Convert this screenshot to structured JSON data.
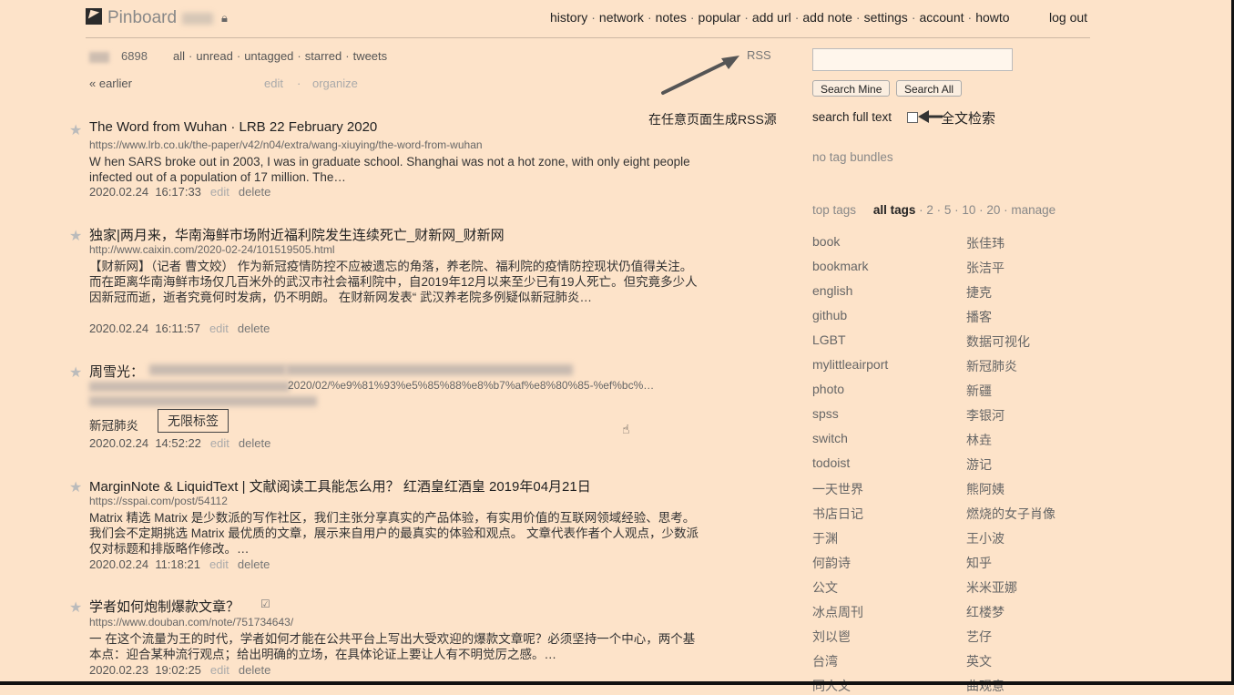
{
  "brand": "Pinboard",
  "topnav": [
    "history",
    "network",
    "notes",
    "popular",
    "add url",
    "add note",
    "settings",
    "account",
    "howto"
  ],
  "logout": "log out",
  "count": "6898",
  "filters": [
    "all",
    "unread",
    "untagged",
    "starred",
    "tweets"
  ],
  "earlier": "« earlier",
  "edit": "edit",
  "organize": "organize",
  "rss": "RSS",
  "rss_annotation": "在任意页面生成RSS源",
  "bookmarks": [
    {
      "title": "The Word from Wuhan · LRB 22 February 2020",
      "url": "https://www.lrb.co.uk/the-paper/v42/n04/extra/wang-xiuying/the-word-from-wuhan",
      "desc": "W hen SARS broke out in 2003, I was in graduate school. Shanghai was not a hot zone, with only eight people infected out of a population of 17 million. The…",
      "date": "2020.02.24",
      "time": "16:17:33",
      "edit": "edit",
      "delete": "delete"
    },
    {
      "title": "独家|两月来，华南海鲜市场附近福利院发生连续死亡_财新网_财新网",
      "url": "http://www.caixin.com/2020-02-24/101519505.html",
      "desc": "【财新网】（记者 曹文姣） 作为新冠疫情防控不应被遗忘的角落，养老院、福利院的疫情防控现状仍值得关注。而在距离华南海鲜市场仅几百米外的武汉市社会福利院中，自2019年12月以来至少已有19人死亡。但究竟多少人因新冠而逝，逝者究竟何时发病，仍不明朗。 在财新网发表“ 武汉养老院多例疑似新冠肺炎…",
      "date": "2020.02.24",
      "time": "16:11:57",
      "edit": "edit",
      "delete": "delete"
    },
    {
      "title": "周雪光：",
      "url": "2020/02/%e9%81%93%e5%85%88%e8%b7%af%e8%80%85-%ef%bc%…",
      "tags": [
        "新冠肺炎",
        "无限标签"
      ],
      "date": "2020.02.24",
      "time": "14:52:22",
      "edit": "edit",
      "delete": "delete"
    },
    {
      "title": "MarginNote & LiquidText | 文献阅读工具能怎么用？ 红酒皇红酒皇 2019年04月21日",
      "url": "https://sspai.com/post/54112",
      "desc": "Matrix 精选 Matrix 是少数派的写作社区，我们主张分享真实的产品体验，有实用价值的互联网领域经验、思考。我们会不定期挑选 Matrix 最优质的文章，展示来自用户的最真实的体验和观点。 文章代表作者个人观点，少数派仅对标题和排版略作修改。…",
      "date": "2020.02.24",
      "time": "11:18:21",
      "edit": "edit",
      "delete": "delete"
    },
    {
      "title": "学者如何炮制爆款文章？",
      "url": "https://www.douban.com/note/751734643/",
      "desc": "一 在这个流量为王的时代，学者如何才能在公共平台上写出大受欢迎的爆款文章呢？必须坚持一个中心，两个基本点：迎合某种流行观点；给出明确的立场，在具体论证上要让人有不明觉厉之感。…",
      "date": "2020.02.23",
      "time": "19:02:25",
      "edit": "edit",
      "delete": "delete"
    }
  ],
  "search": {
    "mine": "Search Mine",
    "all": "Search All",
    "full_text": "search full text",
    "full_text_annotation": "全文检索"
  },
  "no_bundles": "no tag bundles",
  "tagtabs": {
    "top": "top tags",
    "all": "all tags",
    "rest": " · 2 · 5 · 10 · 20 · manage"
  },
  "tags_left": [
    "book",
    "bookmark",
    "english",
    "github",
    "LGBT",
    "mylittleairport",
    "photo",
    "spss",
    "switch",
    "todoist",
    "一天世界",
    "书店日记",
    "于渊",
    "何韵诗",
    "公文",
    "冰点周刊",
    "刘以鬯",
    "台湾",
    "同人文"
  ],
  "tags_right": [
    "张佳玮",
    "张洁平",
    "捷克",
    "播客",
    "数据可视化",
    "新冠肺炎",
    "新疆",
    "李银河",
    "林垚",
    "游记",
    "熊阿姨",
    "燃烧的女子肖像",
    "王小波",
    "知乎",
    "米米亚娜",
    "红楼梦",
    "艺仔",
    "英文",
    "曲观意"
  ]
}
